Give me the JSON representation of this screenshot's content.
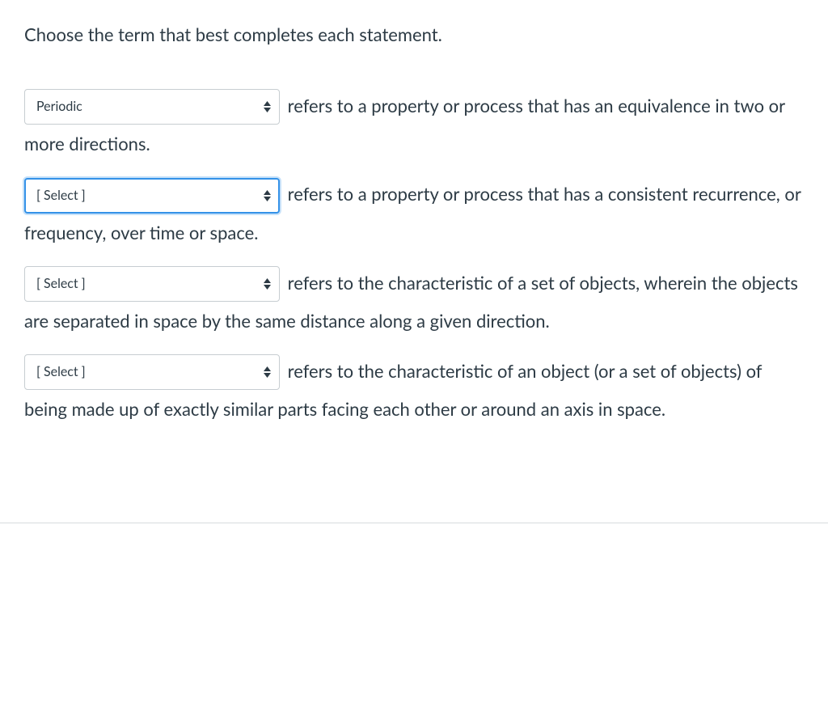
{
  "instructions": "Choose the term that best completes each statement.",
  "placeholder": "[ Select ]",
  "statements": [
    {
      "selected": "Periodic",
      "focused": false,
      "text_after": " refers to a property or process that has an equivalence in two or more directions."
    },
    {
      "selected": "[ Select ]",
      "focused": true,
      "text_after": " refers to a property or process that has a consistent recurrence, or frequency, over time or space."
    },
    {
      "selected": "[ Select ]",
      "focused": false,
      "text_after": " refers to the characteristic of a set of objects, wherein the objects are separated in space by the same distance along a given direction."
    },
    {
      "selected": "[ Select ]",
      "focused": false,
      "text_after": " refers to the characteristic of an object (or a set of objects) of being made up of exactly similar parts facing each other or around an axis in space."
    }
  ]
}
